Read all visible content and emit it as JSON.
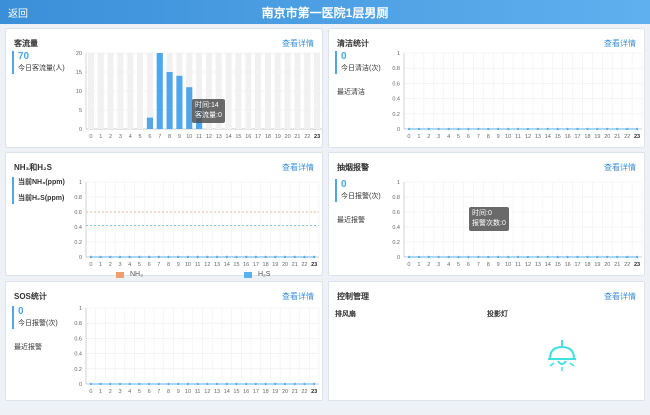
{
  "header": {
    "back_label": "返回",
    "title": "南京市第一医院1层男厕"
  },
  "link_label": "查看详情",
  "traffic": {
    "title": "客流量",
    "count": "70",
    "count_label": "今日客流量(人)",
    "tooltip": {
      "line1": "时间:14",
      "line2": "客流量:0"
    }
  },
  "cleaning": {
    "title": "清洁统计",
    "count": "0",
    "count_label": "今日清洁(次)",
    "recent_label": "最近清洁"
  },
  "gas": {
    "title": "NH₃和H₂S",
    "nh3_label": "当前NH₃(ppm)",
    "h2s_label": "当前H₂S(ppm)",
    "legend": [
      "NH₃",
      "H₂S"
    ]
  },
  "smoke": {
    "title": "抽烟报警",
    "count": "0",
    "count_label": "今日报警(次)",
    "recent_label": "最近报警",
    "tooltip": {
      "line1": "时间:0",
      "line2": "报警次数:0"
    }
  },
  "sos": {
    "title": "SOS统计",
    "count": "0",
    "count_label": "今日报警(次)",
    "recent_label": "最近报警"
  },
  "control": {
    "title": "控制管理",
    "fan_label": "排风扇",
    "lamp_label": "投影灯"
  },
  "colors": {
    "accent": "#4fa6ea",
    "nh3_line": "#f0a070",
    "h2s_line": "#5ab0ee",
    "lamp": "#3ee0e0"
  },
  "chart_data": [
    {
      "type": "bar",
      "categories": [
        "0",
        "1",
        "2",
        "3",
        "4",
        "5",
        "6",
        "7",
        "8",
        "9",
        "10",
        "11",
        "12",
        "13",
        "14",
        "15",
        "16",
        "17",
        "18",
        "19",
        "20",
        "21",
        "22",
        "23"
      ],
      "values": [
        0,
        0,
        0,
        0,
        0,
        0,
        3,
        20,
        15,
        14,
        11,
        7,
        0,
        0,
        0,
        0,
        0,
        0,
        0,
        0,
        0,
        0,
        0,
        0
      ],
      "ylim": [
        0,
        20
      ],
      "yticks": [
        "0",
        "5",
        "10",
        "15",
        "20"
      ]
    },
    {
      "type": "line",
      "categories": [
        "0",
        "1",
        "2",
        "3",
        "4",
        "5",
        "6",
        "7",
        "8",
        "9",
        "10",
        "11",
        "12",
        "13",
        "14",
        "15",
        "16",
        "17",
        "18",
        "19",
        "20",
        "21",
        "22",
        "23"
      ],
      "values": [
        0,
        0,
        0,
        0,
        0,
        0,
        0,
        0,
        0,
        0,
        0,
        0,
        0,
        0,
        0,
        0,
        0,
        0,
        0,
        0,
        0,
        0,
        0,
        0
      ],
      "ylim": [
        0,
        1
      ],
      "yticks": [
        "0",
        "0.2",
        "0.4",
        "0.6",
        "0.8",
        "1"
      ]
    },
    {
      "type": "line",
      "categories": [
        "0",
        "1",
        "2",
        "3",
        "4",
        "5",
        "6",
        "7",
        "8",
        "9",
        "10",
        "11",
        "12",
        "13",
        "14",
        "15",
        "16",
        "17",
        "18",
        "19",
        "20",
        "21",
        "22",
        "23"
      ],
      "series": [
        {
          "name": "NH₃",
          "values": [
            0,
            0,
            0,
            0,
            0,
            0,
            0,
            0,
            0,
            0,
            0,
            0,
            0,
            0,
            0,
            0,
            0,
            0,
            0,
            0,
            0,
            0,
            0,
            0
          ]
        },
        {
          "name": "H₂S",
          "values": [
            0,
            0,
            0,
            0,
            0,
            0,
            0,
            0,
            0,
            0,
            0,
            0,
            0,
            0,
            0,
            0,
            0,
            0,
            0,
            0,
            0,
            0,
            0,
            0
          ]
        }
      ],
      "thresholds": [
        0.6,
        0.42
      ],
      "ylim": [
        0,
        1
      ],
      "yticks": [
        "0",
        "0.2",
        "0.4",
        "0.6",
        "0.8",
        "1"
      ]
    },
    {
      "type": "line",
      "categories": [
        "0",
        "1",
        "2",
        "3",
        "4",
        "5",
        "6",
        "7",
        "8",
        "9",
        "10",
        "11",
        "12",
        "13",
        "14",
        "15",
        "16",
        "17",
        "18",
        "19",
        "20",
        "21",
        "22",
        "23"
      ],
      "values": [
        0,
        0,
        0,
        0,
        0,
        0,
        0,
        0,
        0,
        0,
        0,
        0,
        0,
        0,
        0,
        0,
        0,
        0,
        0,
        0,
        0,
        0,
        0,
        0
      ],
      "ylim": [
        0,
        1
      ],
      "yticks": [
        "0",
        "0.2",
        "0.4",
        "0.6",
        "0.8",
        "1"
      ]
    },
    {
      "type": "line",
      "categories": [
        "0",
        "1",
        "2",
        "3",
        "4",
        "5",
        "6",
        "7",
        "8",
        "9",
        "10",
        "11",
        "12",
        "13",
        "14",
        "15",
        "16",
        "17",
        "18",
        "19",
        "20",
        "21",
        "22",
        "23"
      ],
      "values": [
        0,
        0,
        0,
        0,
        0,
        0,
        0,
        0,
        0,
        0,
        0,
        0,
        0,
        0,
        0,
        0,
        0,
        0,
        0,
        0,
        0,
        0,
        0,
        0
      ],
      "ylim": [
        0,
        1
      ],
      "yticks": [
        "0",
        "0.2",
        "0.4",
        "0.6",
        "0.8",
        "1"
      ]
    }
  ]
}
